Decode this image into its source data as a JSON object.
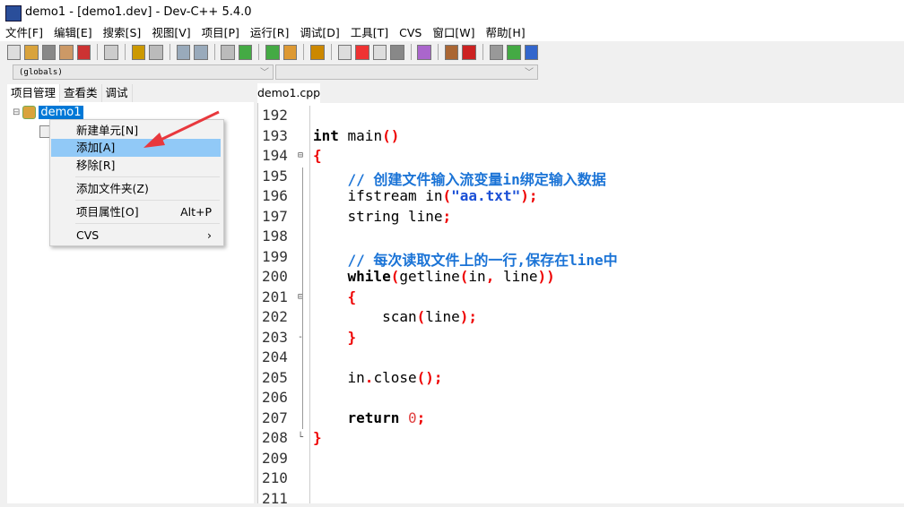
{
  "window": {
    "title": "demo1 - [demo1.dev] - Dev-C++ 5.4.0"
  },
  "menu": [
    "文件[F]",
    "编辑[E]",
    "搜索[S]",
    "视图[V]",
    "项目[P]",
    "运行[R]",
    "调试[D]",
    "工具[T]",
    "CVS",
    "窗口[W]",
    "帮助[H]"
  ],
  "scope_combo": {
    "value": "(globals)"
  },
  "left_tabs": [
    "项目管理",
    "查看类",
    "调试"
  ],
  "tree": {
    "root": "demo1"
  },
  "context_menu": [
    {
      "label": "新建单元[N]"
    },
    {
      "label": "添加[A]",
      "highlighted": true
    },
    {
      "label": "移除[R]"
    },
    {
      "label": "添加文件夹(Z)"
    },
    {
      "label": "项目属性[O]",
      "shortcut": "Alt+P"
    },
    {
      "label": "CVS",
      "submenu": true
    }
  ],
  "editor": {
    "tab": "demo1.cpp",
    "lines": [
      {
        "n": "192",
        "html": ""
      },
      {
        "n": "193",
        "html": "<span class='kw'>int</span> main<span class='p'>()</span>"
      },
      {
        "n": "194",
        "html": "<span class='p'>{</span>",
        "fold": "⊟"
      },
      {
        "n": "195",
        "html": "    <span class='cm'>// 创建文件输入流变量in绑定输入数据</span>"
      },
      {
        "n": "196",
        "html": "    ifstream in<span class='p'>(</span><span class='str'>\"aa.txt\"</span><span class='p'>);</span>"
      },
      {
        "n": "197",
        "html": "    string line<span class='p'>;</span>"
      },
      {
        "n": "198",
        "html": ""
      },
      {
        "n": "199",
        "html": "    <span class='cm'>// 每次读取文件上的一行,保存在line中</span>"
      },
      {
        "n": "200",
        "html": "    <span class='kw'>while</span><span class='p'>(</span>getline<span class='p'>(</span>in<span class='p'>,</span> line<span class='p'>))</span>"
      },
      {
        "n": "201",
        "html": "    <span class='p'>{</span>",
        "fold": "⊟"
      },
      {
        "n": "202",
        "html": "        scan<span class='p'>(</span>line<span class='p'>);</span>"
      },
      {
        "n": "203",
        "html": "    <span class='p'>}</span>",
        "fold": "-"
      },
      {
        "n": "204",
        "html": ""
      },
      {
        "n": "205",
        "html": "    in<span class='p'>.</span>close<span class='p'>();</span>"
      },
      {
        "n": "206",
        "html": ""
      },
      {
        "n": "207",
        "html": "    <span class='kw'>return</span> <span class='num'>0</span><span class='p'>;</span>"
      },
      {
        "n": "208",
        "html": "<span class='p'>}</span>",
        "fold": "└"
      },
      {
        "n": "209",
        "html": ""
      },
      {
        "n": "210",
        "html": ""
      },
      {
        "n": "211",
        "html": ""
      }
    ]
  },
  "colors": {
    "selection": "#0078d7",
    "menu_highlight": "#91c9f7",
    "arrow": "#e8383d",
    "comment": "#1a73d6",
    "paren": "#ee0000"
  }
}
